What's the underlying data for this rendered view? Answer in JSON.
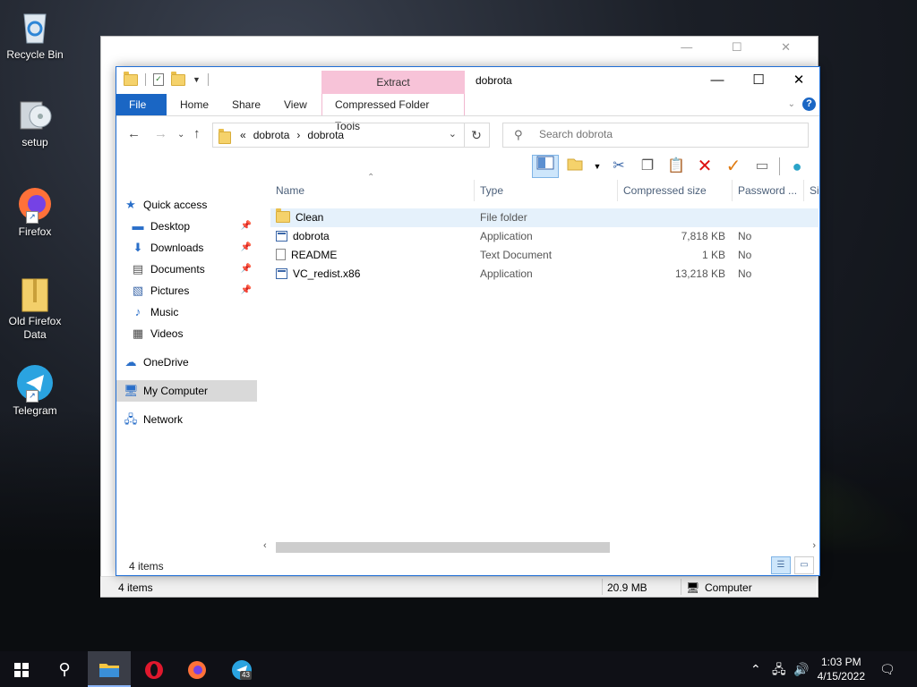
{
  "desktop": {
    "icons": [
      {
        "label": "Recycle Bin"
      },
      {
        "label": "setup"
      },
      {
        "label": "Firefox"
      },
      {
        "label": "Old Firefox Data"
      },
      {
        "label": "Telegram"
      }
    ]
  },
  "window": {
    "title": "dobrota",
    "context_group": "Extract",
    "tabs": {
      "file": "File",
      "home": "Home",
      "share": "Share",
      "view": "View",
      "context": "Compressed Folder Tools"
    },
    "controls": {
      "minimize": "—",
      "maximize": "☐",
      "close": "✕"
    },
    "help": "?"
  },
  "address": {
    "prefix": "«",
    "crumbs": [
      "dobrota",
      "dobrota"
    ]
  },
  "search": {
    "placeholder": "Search dobrota"
  },
  "nav_pane": {
    "items": [
      {
        "label": "Quick access"
      },
      {
        "label": "Desktop",
        "pinned": true
      },
      {
        "label": "Downloads",
        "pinned": true
      },
      {
        "label": "Documents",
        "pinned": true
      },
      {
        "label": "Pictures",
        "pinned": true
      },
      {
        "label": "Music"
      },
      {
        "label": "Videos"
      },
      {
        "label": "OneDrive"
      },
      {
        "label": "My Computer",
        "selected": true
      },
      {
        "label": "Network"
      }
    ]
  },
  "file_list": {
    "columns": [
      "Name",
      "Type",
      "Compressed size",
      "Password ...",
      "Si"
    ],
    "rows": [
      {
        "name": "Clean",
        "type": "File folder",
        "size": "",
        "password": "",
        "icon": "folder-icon"
      },
      {
        "name": "dobrota",
        "type": "Application",
        "size": "7,818 KB",
        "password": "No",
        "icon": "application-icon"
      },
      {
        "name": "README",
        "type": "Text Document",
        "size": "1 KB",
        "password": "No",
        "icon": "text-document-icon"
      },
      {
        "name": "VC_redist.x86",
        "type": "Application",
        "size": "13,218 KB",
        "password": "No",
        "icon": "application-icon"
      }
    ]
  },
  "status": {
    "items": "4 items",
    "bg_items": "4 items",
    "bg_size": "20.9 MB",
    "bg_location": "Computer"
  },
  "taskbar": {
    "time": "1:03 PM",
    "date": "4/15/2022",
    "telegram_badge": "43"
  },
  "colors": {
    "accent": "#1a66c4",
    "context_tab": "#f7c3d8",
    "selection": "#d9d9d9",
    "row_highlight": "#e5f1fb"
  }
}
